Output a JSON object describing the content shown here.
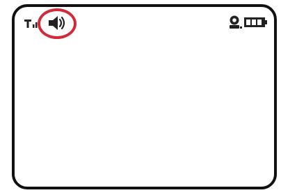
{
  "status_bar": {
    "icons": {
      "signal": "signal-strength-icon",
      "speaker": "speaker-volume-icon",
      "camera": "camera-user-icon",
      "battery": "battery-icon"
    },
    "battery_level": 1.0,
    "highlight_color": "#d12b3a"
  },
  "colors": {
    "frame": "#111111",
    "background": "#ffffff"
  }
}
